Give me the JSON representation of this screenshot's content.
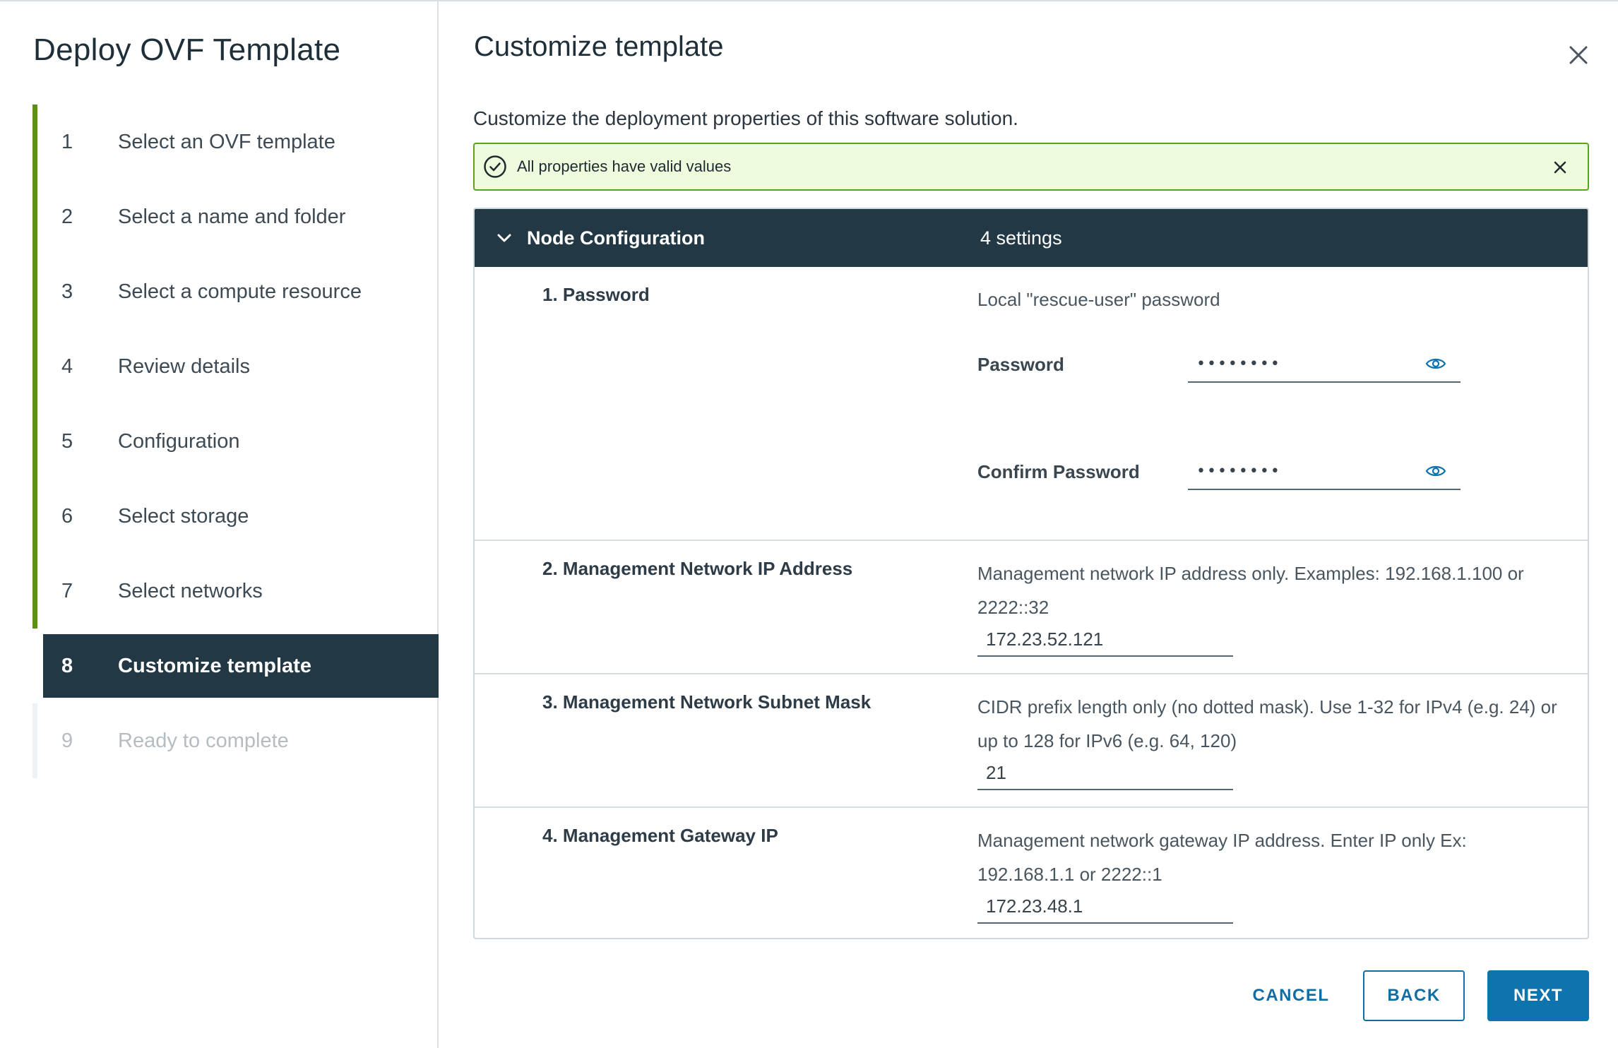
{
  "wizard": {
    "title": "Deploy OVF Template",
    "steps": [
      {
        "num": "1",
        "label": "Select an OVF template"
      },
      {
        "num": "2",
        "label": "Select a name and folder"
      },
      {
        "num": "3",
        "label": "Select a compute resource"
      },
      {
        "num": "4",
        "label": "Review details"
      },
      {
        "num": "5",
        "label": "Configuration"
      },
      {
        "num": "6",
        "label": "Select storage"
      },
      {
        "num": "7",
        "label": "Select networks"
      },
      {
        "num": "8",
        "label": "Customize template"
      },
      {
        "num": "9",
        "label": "Ready to complete"
      }
    ],
    "current_step": 8
  },
  "main": {
    "title": "Customize template",
    "subtitle": "Customize the deployment properties of this software solution.",
    "alert": {
      "text": "All properties have valid values",
      "status_color": "#5aa220"
    },
    "group": {
      "name": "Node Configuration",
      "count": "4 settings"
    },
    "properties": {
      "password": {
        "name": "1. Password",
        "description": "Local \"rescue-user\" password",
        "password_label": "Password",
        "password_value": "••••••••",
        "confirm_label": "Confirm Password",
        "confirm_value": "••••••••"
      },
      "ip": {
        "name": "2. Management Network IP Address",
        "description": "Management network IP address only. Examples: 192.168.1.100 or 2222::32",
        "value": "172.23.52.121"
      },
      "mask": {
        "name": "3. Management Network Subnet Mask",
        "description": "CIDR prefix length only (no dotted mask). Use 1-32 for IPv4 (e.g. 24) or up to 128 for IPv6 (e.g. 64, 120)",
        "value": "21"
      },
      "gateway": {
        "name": "4. Management Gateway IP",
        "description": "Management network gateway IP address. Enter IP only Ex: 192.168.1.1 or 2222::1",
        "value": "172.23.48.1"
      }
    }
  },
  "footer": {
    "cancel_label": "CANCEL",
    "back_label": "BACK",
    "next_label": "NEXT"
  },
  "colors": {
    "header_dark": "#233845",
    "progress_green": "#5a8f1f",
    "primary_blue": "#0f73ad",
    "alert_bg": "#eefbdc"
  },
  "icons": {
    "close": "close-icon",
    "check": "check-circle-icon",
    "chevron": "chevron-down-icon",
    "eye": "eye-icon"
  }
}
